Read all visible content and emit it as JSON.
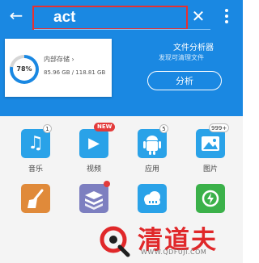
{
  "topbar": {
    "search_value": "act"
  },
  "storage": {
    "percent": 78,
    "percent_label": "78%",
    "title": "内部存储 ›",
    "size_text": "85.96 GB / 118.81 GB"
  },
  "analyzer": {
    "title": "文件分析器",
    "subtitle": "发现可清理文件",
    "button_label": "分析"
  },
  "categories": [
    {
      "label": "音乐",
      "icon": "music-note-icon",
      "badge": "1",
      "color": "#2aa2e8"
    },
    {
      "label": "视频",
      "icon": "video-play-icon",
      "badge": "NEW",
      "color": "#2aa2e8"
    },
    {
      "label": "应用",
      "icon": "android-app-icon",
      "badge": "5",
      "color": "#2aa2e8"
    },
    {
      "label": "图片",
      "icon": "picture-icon",
      "badge": "999+",
      "color": "#2aa2e8"
    },
    {
      "label": "",
      "icon": "broom-cleaner-icon",
      "badge": "",
      "color": "#e08a3a"
    },
    {
      "label": "",
      "icon": "stack-archive-icon",
      "badge": "",
      "color": "#7d7fc0"
    },
    {
      "label": "",
      "icon": "cloud-icon",
      "badge": "",
      "color": "#2aa2e8"
    },
    {
      "label": "",
      "icon": "sync-lightning-icon",
      "badge": "",
      "color": "#3bb14a"
    }
  ],
  "watermark": {
    "brand": "清道夫",
    "url": "WWW.QDFUJI.COM"
  },
  "colors": {
    "header_blue": "#1a88e2",
    "highlight_red": "#e83030"
  }
}
